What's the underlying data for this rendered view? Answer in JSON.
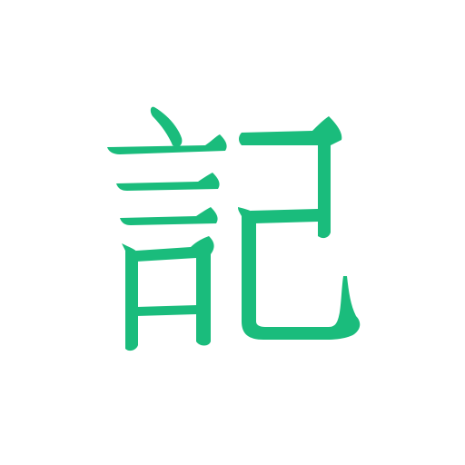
{
  "logo": {
    "character": "記",
    "icon": "notebook-kanji-icon",
    "color": "#1ABC7C",
    "background": "#FFFFFF"
  }
}
